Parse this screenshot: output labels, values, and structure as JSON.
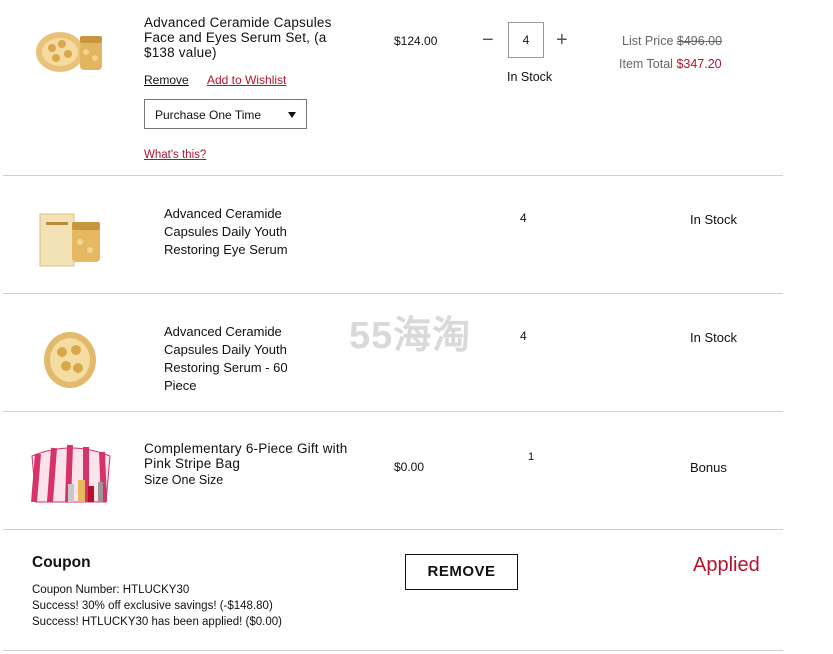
{
  "items": [
    {
      "title": "Advanced Ceramide Capsules Face and Eyes Serum Set, (a $138 value)",
      "remove": "Remove",
      "wishlist": "Add to Wishlist",
      "purchase_option": "Purchase One Time",
      "whats_this": "What's this?",
      "price": "$124.00",
      "qty": "4",
      "qty_minus": "−",
      "qty_plus": "+",
      "stock": "In Stock",
      "list_price_label": "List Price",
      "list_price": "$496.00",
      "item_total_label": "Item Total",
      "item_total": "$347.20"
    },
    {
      "title": "Advanced Ceramide Capsules Daily Youth Restoring Eye Serum",
      "qty": "4",
      "stock": "In Stock"
    },
    {
      "title": "Advanced Ceramide Capsules Daily Youth Restoring Serum - 60 Piece",
      "qty": "4",
      "stock": "In Stock"
    },
    {
      "title": "Complementary 6-Piece Gift with Pink Stripe Bag",
      "size": "Size One Size",
      "price": "$0.00",
      "qty": "1",
      "stock": "Bonus"
    }
  ],
  "coupon": {
    "heading": "Coupon",
    "number": "Coupon Number: HTLUCKY30",
    "line1": "Success! 30% off exclusive savings! (-$148.80)",
    "line2": "Success! HTLUCKY30 has been applied! ($0.00)",
    "remove_label": "REMOVE",
    "status": "Applied"
  },
  "watermark": "55海淘",
  "colors": {
    "accent_red": "#b5122e",
    "gold": "#d9a84a",
    "pink": "#d6336c"
  },
  "icons": [
    "chevron-down-icon"
  ]
}
